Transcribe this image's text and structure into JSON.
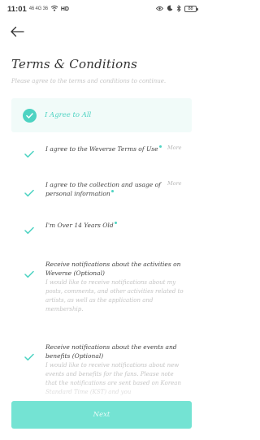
{
  "status_bar": {
    "time": "11:01",
    "network": "46 4G 36",
    "wifi_label": "HD",
    "battery": "88"
  },
  "page": {
    "title": "Terms & Conditions",
    "subtitle": "Please agree to the terms and conditions to continue."
  },
  "agree_all": {
    "label": "I Agree to All",
    "checked": true
  },
  "terms": [
    {
      "label": "I agree to the Weverse Terms of Use",
      "more": "More",
      "required_dot": true,
      "checked": true
    },
    {
      "label": "I agree to the collection and usage of personal information",
      "more": "More",
      "required_dot": true,
      "checked": true
    },
    {
      "label": "I'm Over 14 Years Old",
      "required_dot": true,
      "checked": true
    },
    {
      "label": "Receive notifications about the activities on Weverse (Optional)",
      "description": "I would like to receive notifications about my posts, comments, and other activities related to artists, as well as the application and membership.",
      "checked": true
    },
    {
      "label": "Receive notifications about the events and benefits (Optional)",
      "description": "I would like to receive notifications about new events and benefits for the fans. Please note that the notifications are sent based on Korean Standard Time (KST) and you",
      "checked": true
    }
  ],
  "next_button": {
    "label": "Next"
  },
  "colors": {
    "accent": "#4dd3c2",
    "button": "#74e3d3",
    "highlight_bg": "#f1fbf9"
  }
}
